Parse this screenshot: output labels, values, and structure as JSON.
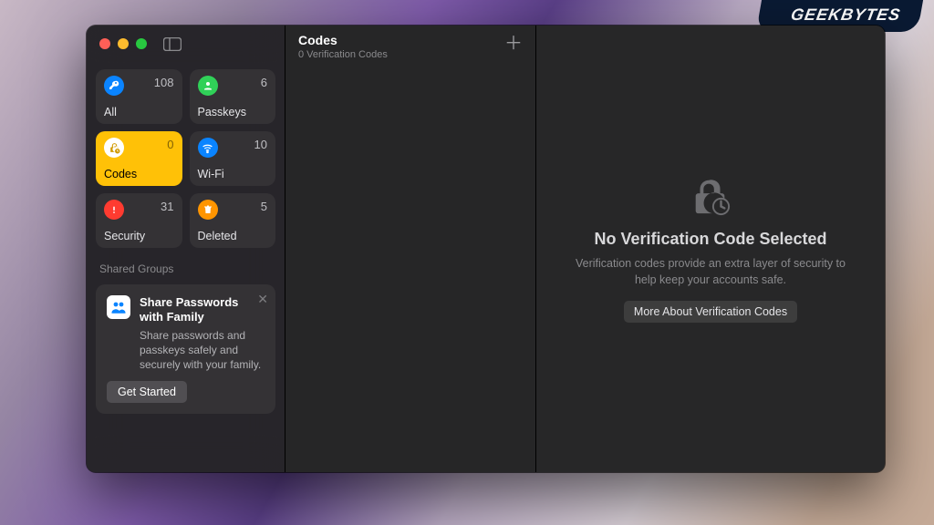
{
  "watermark": "GEEKBYTES",
  "sidebar": {
    "categories": [
      {
        "label": "All",
        "count": "108",
        "color": "#0a84ff",
        "icon": "key"
      },
      {
        "label": "Passkeys",
        "count": "6",
        "color": "#30d158",
        "icon": "person"
      },
      {
        "label": "Codes",
        "count": "0",
        "color": "#ffc107",
        "icon": "lock-clock",
        "selected": true
      },
      {
        "label": "Wi-Fi",
        "count": "10",
        "color": "#0a84ff",
        "icon": "wifi"
      },
      {
        "label": "Security",
        "count": "31",
        "color": "#ff3b30",
        "icon": "alert"
      },
      {
        "label": "Deleted",
        "count": "5",
        "color": "#ff9500",
        "icon": "trash"
      }
    ],
    "shared_heading": "Shared Groups",
    "share": {
      "title": "Share Passwords with Family",
      "desc": "Share passwords and passkeys safely and securely with your family.",
      "button": "Get Started"
    }
  },
  "middle": {
    "title": "Codes",
    "subtitle": "0 Verification Codes"
  },
  "detail": {
    "heading": "No Verification Code Selected",
    "body": "Verification codes provide an extra layer of security to help keep your accounts safe.",
    "button": "More About Verification Codes"
  }
}
